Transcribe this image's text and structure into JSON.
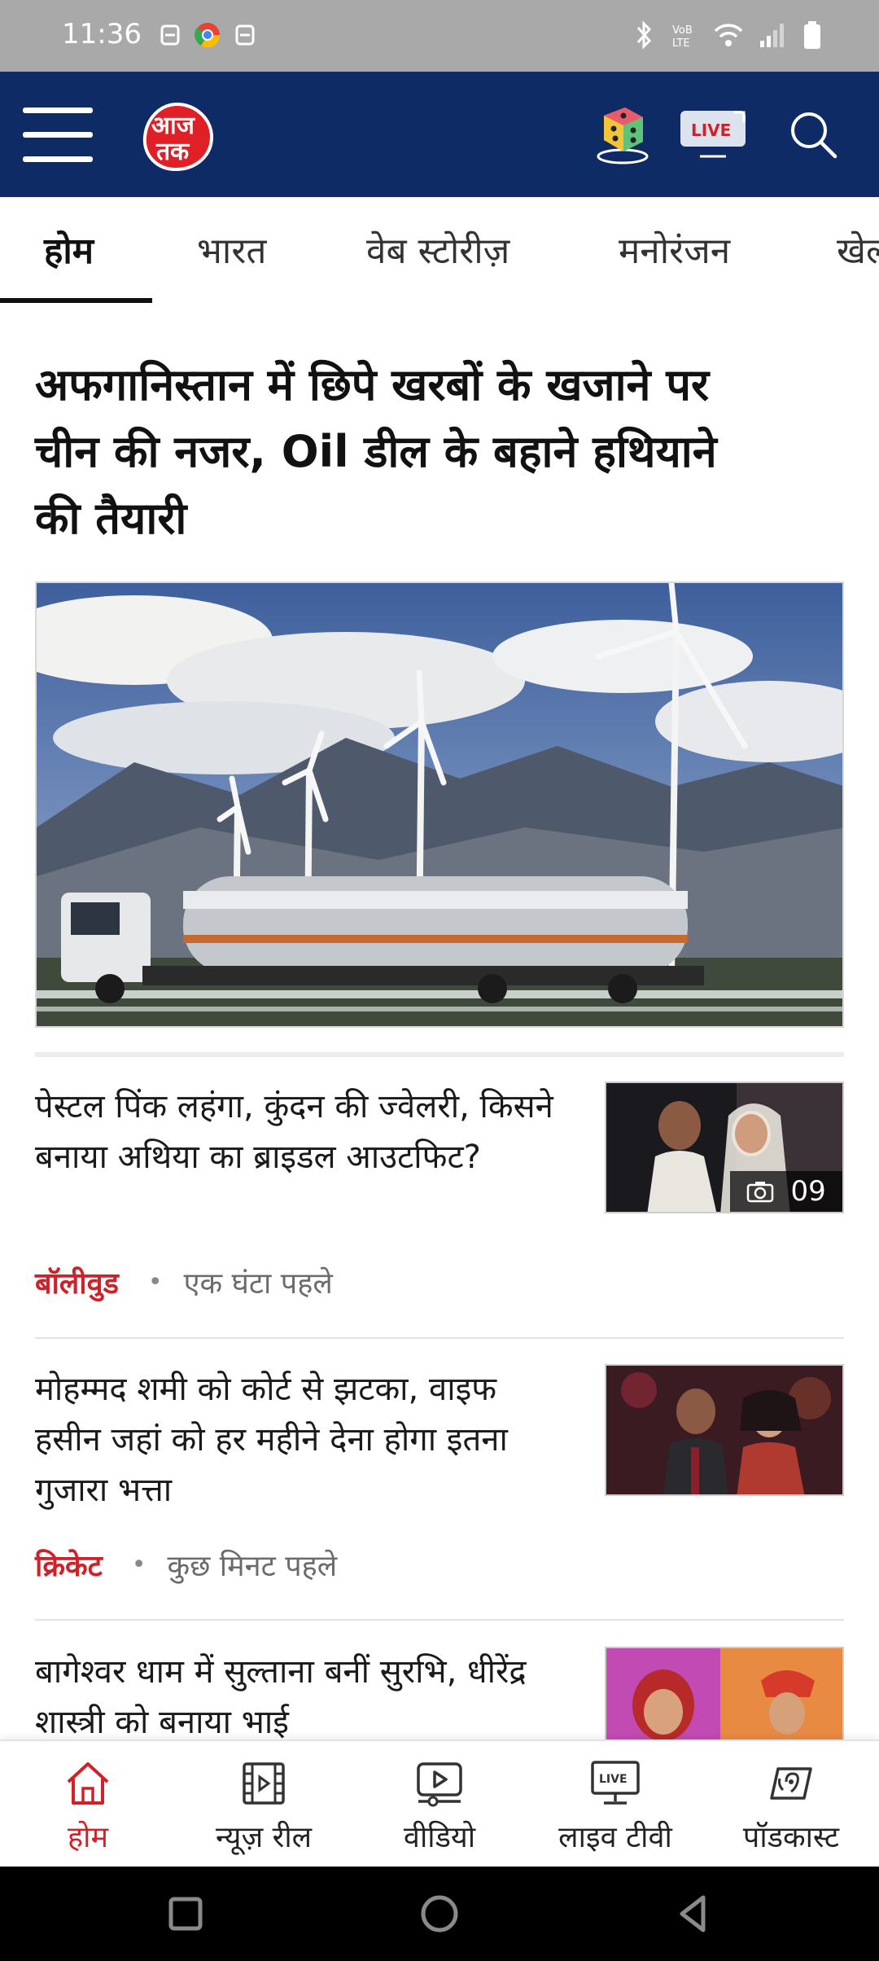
{
  "status_bar": {
    "time": "11:36"
  },
  "header": {
    "logo_text": "आज तक",
    "live_label": "LIVE"
  },
  "tabs": [
    {
      "label": "होम",
      "active": true
    },
    {
      "label": "भारत",
      "active": false
    },
    {
      "label": "वेब स्टोरीज़",
      "active": false
    },
    {
      "label": "मनोरंजन",
      "active": false
    },
    {
      "label": "खेल",
      "active": false
    }
  ],
  "lead_story": {
    "title": "अफगानिस्तान में छिपे खरबों के खजाने पर चीन की नजर, Oil डील के बहाने हथियाने की तैयारी"
  },
  "news": [
    {
      "title": "पेस्टल पिंक लहंगा, कुंदन की ज्वेलरी, किसने बनाया अथिया का ब्राइडल आउटफिट?",
      "category": "बॉलीवुड",
      "time": "एक घंटा पहले",
      "photo_count": "09"
    },
    {
      "title": "मोहम्मद शमी को कोर्ट से झटका, वाइफ हसीन जहां को हर महीने देना होगा इतना गुजारा भत्ता",
      "category": "क्रिकेट",
      "time": "कुछ मिनट पहले"
    },
    {
      "title": "बागेश्वर धाम में सुल्ताना बनीं सुरभि, धीरेंद्र शास्त्री को बनाया भाई"
    }
  ],
  "bottom_nav": [
    {
      "label": "होम",
      "icon": "home-icon",
      "active": true
    },
    {
      "label": "न्यूज़ रील",
      "icon": "film-reel-icon",
      "active": false
    },
    {
      "label": "वीडियो",
      "icon": "video-play-icon",
      "active": false
    },
    {
      "label": "लाइव टीवी",
      "icon": "live-tv-icon",
      "active": false
    },
    {
      "label": "पॉडकास्ट",
      "icon": "podcast-icon",
      "active": false
    }
  ],
  "colors": {
    "header_bg": "#0f2b66",
    "accent_red": "#d02028",
    "status_bar_bg": "#a9a9a9"
  }
}
